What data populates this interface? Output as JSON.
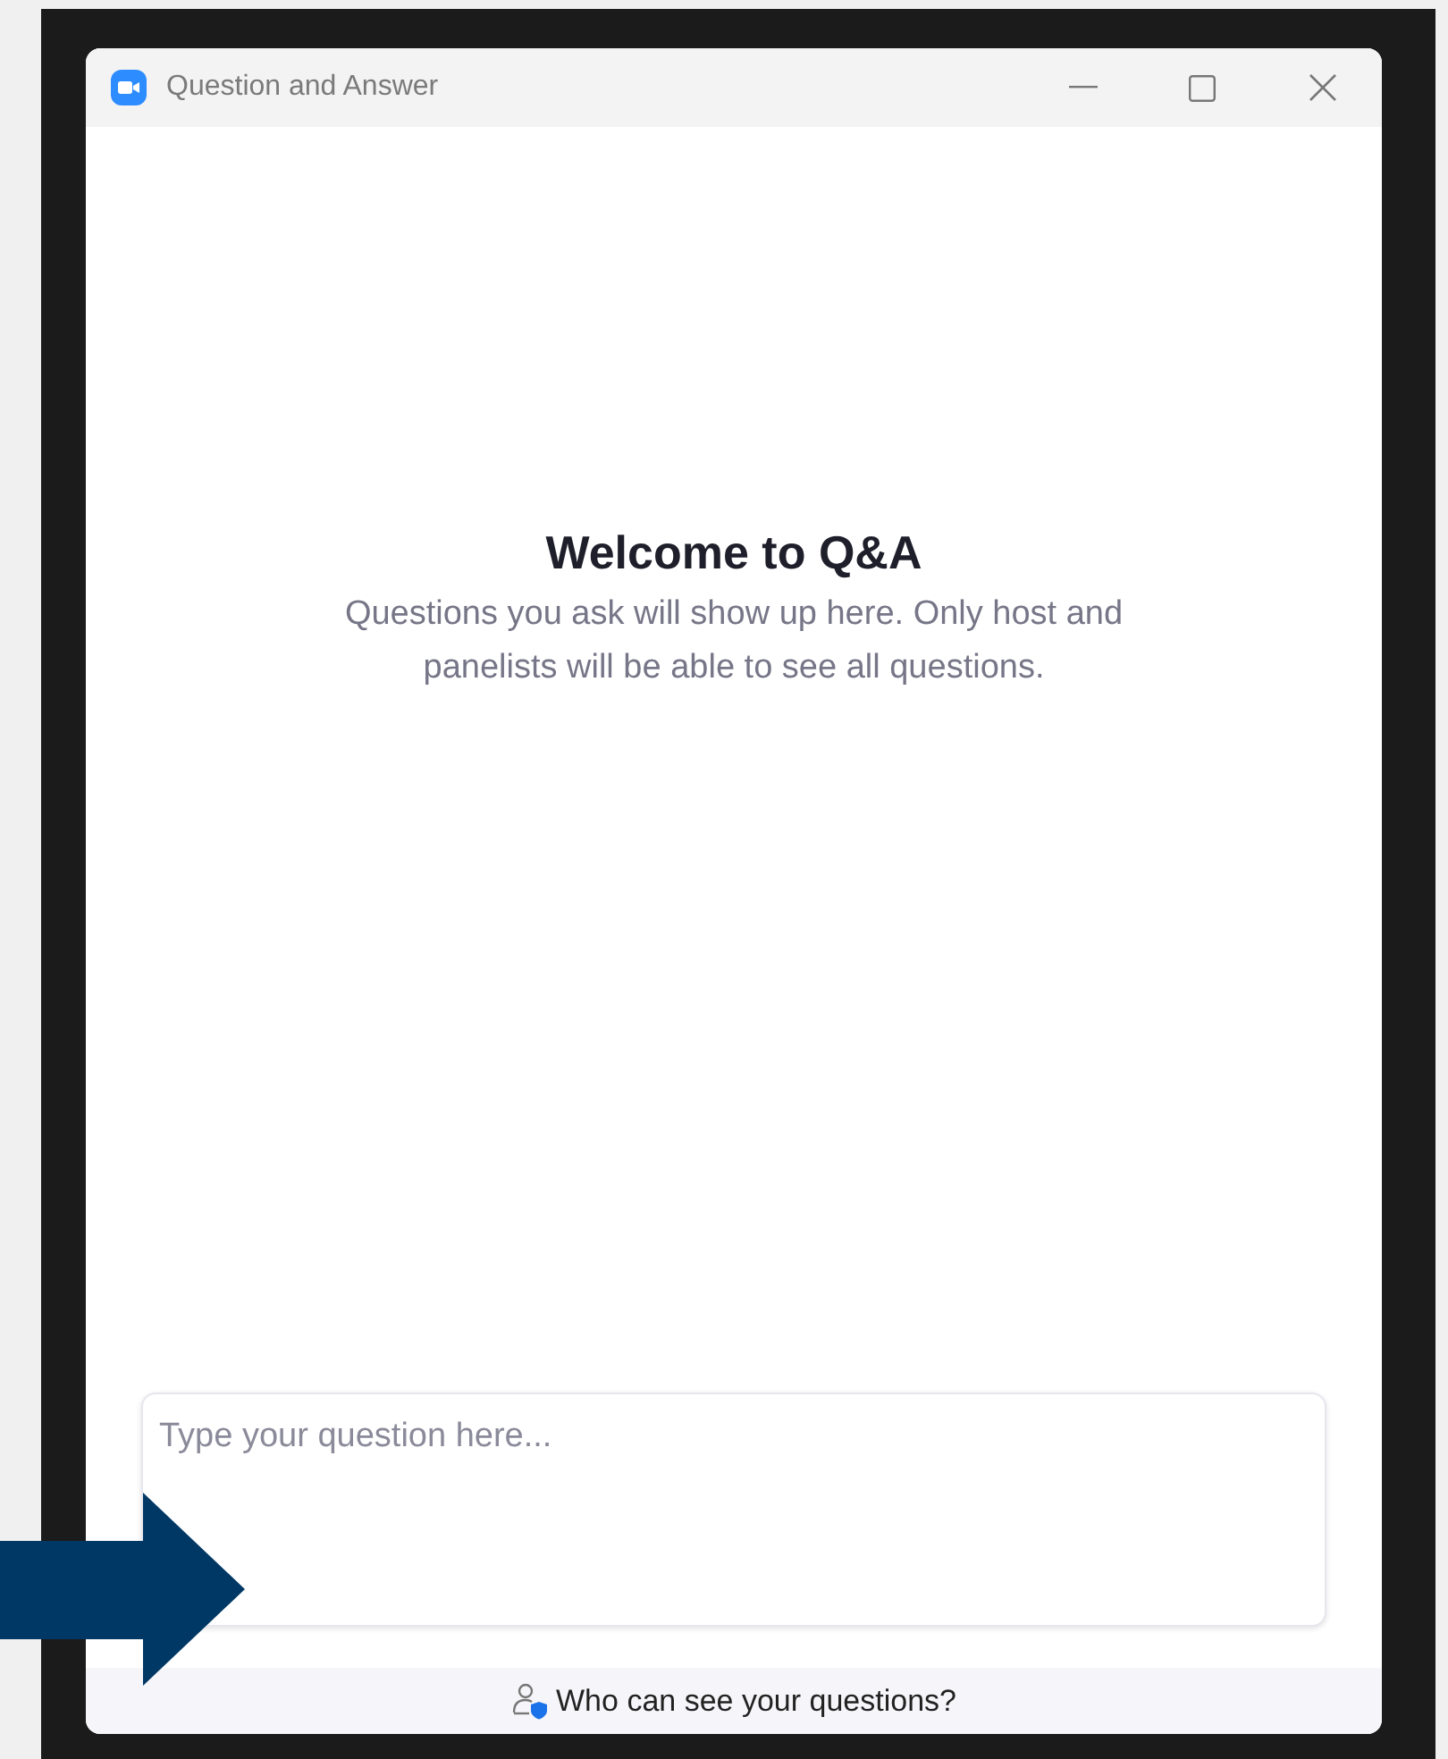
{
  "window": {
    "title": "Question and Answer"
  },
  "welcome": {
    "heading": "Welcome to Q&A",
    "message": "Questions you ask will show up here. Only host and panelists will be able to see all questions."
  },
  "question_input": {
    "placeholder": "Type your question here..."
  },
  "footer": {
    "link": "Who can see your questions?"
  }
}
